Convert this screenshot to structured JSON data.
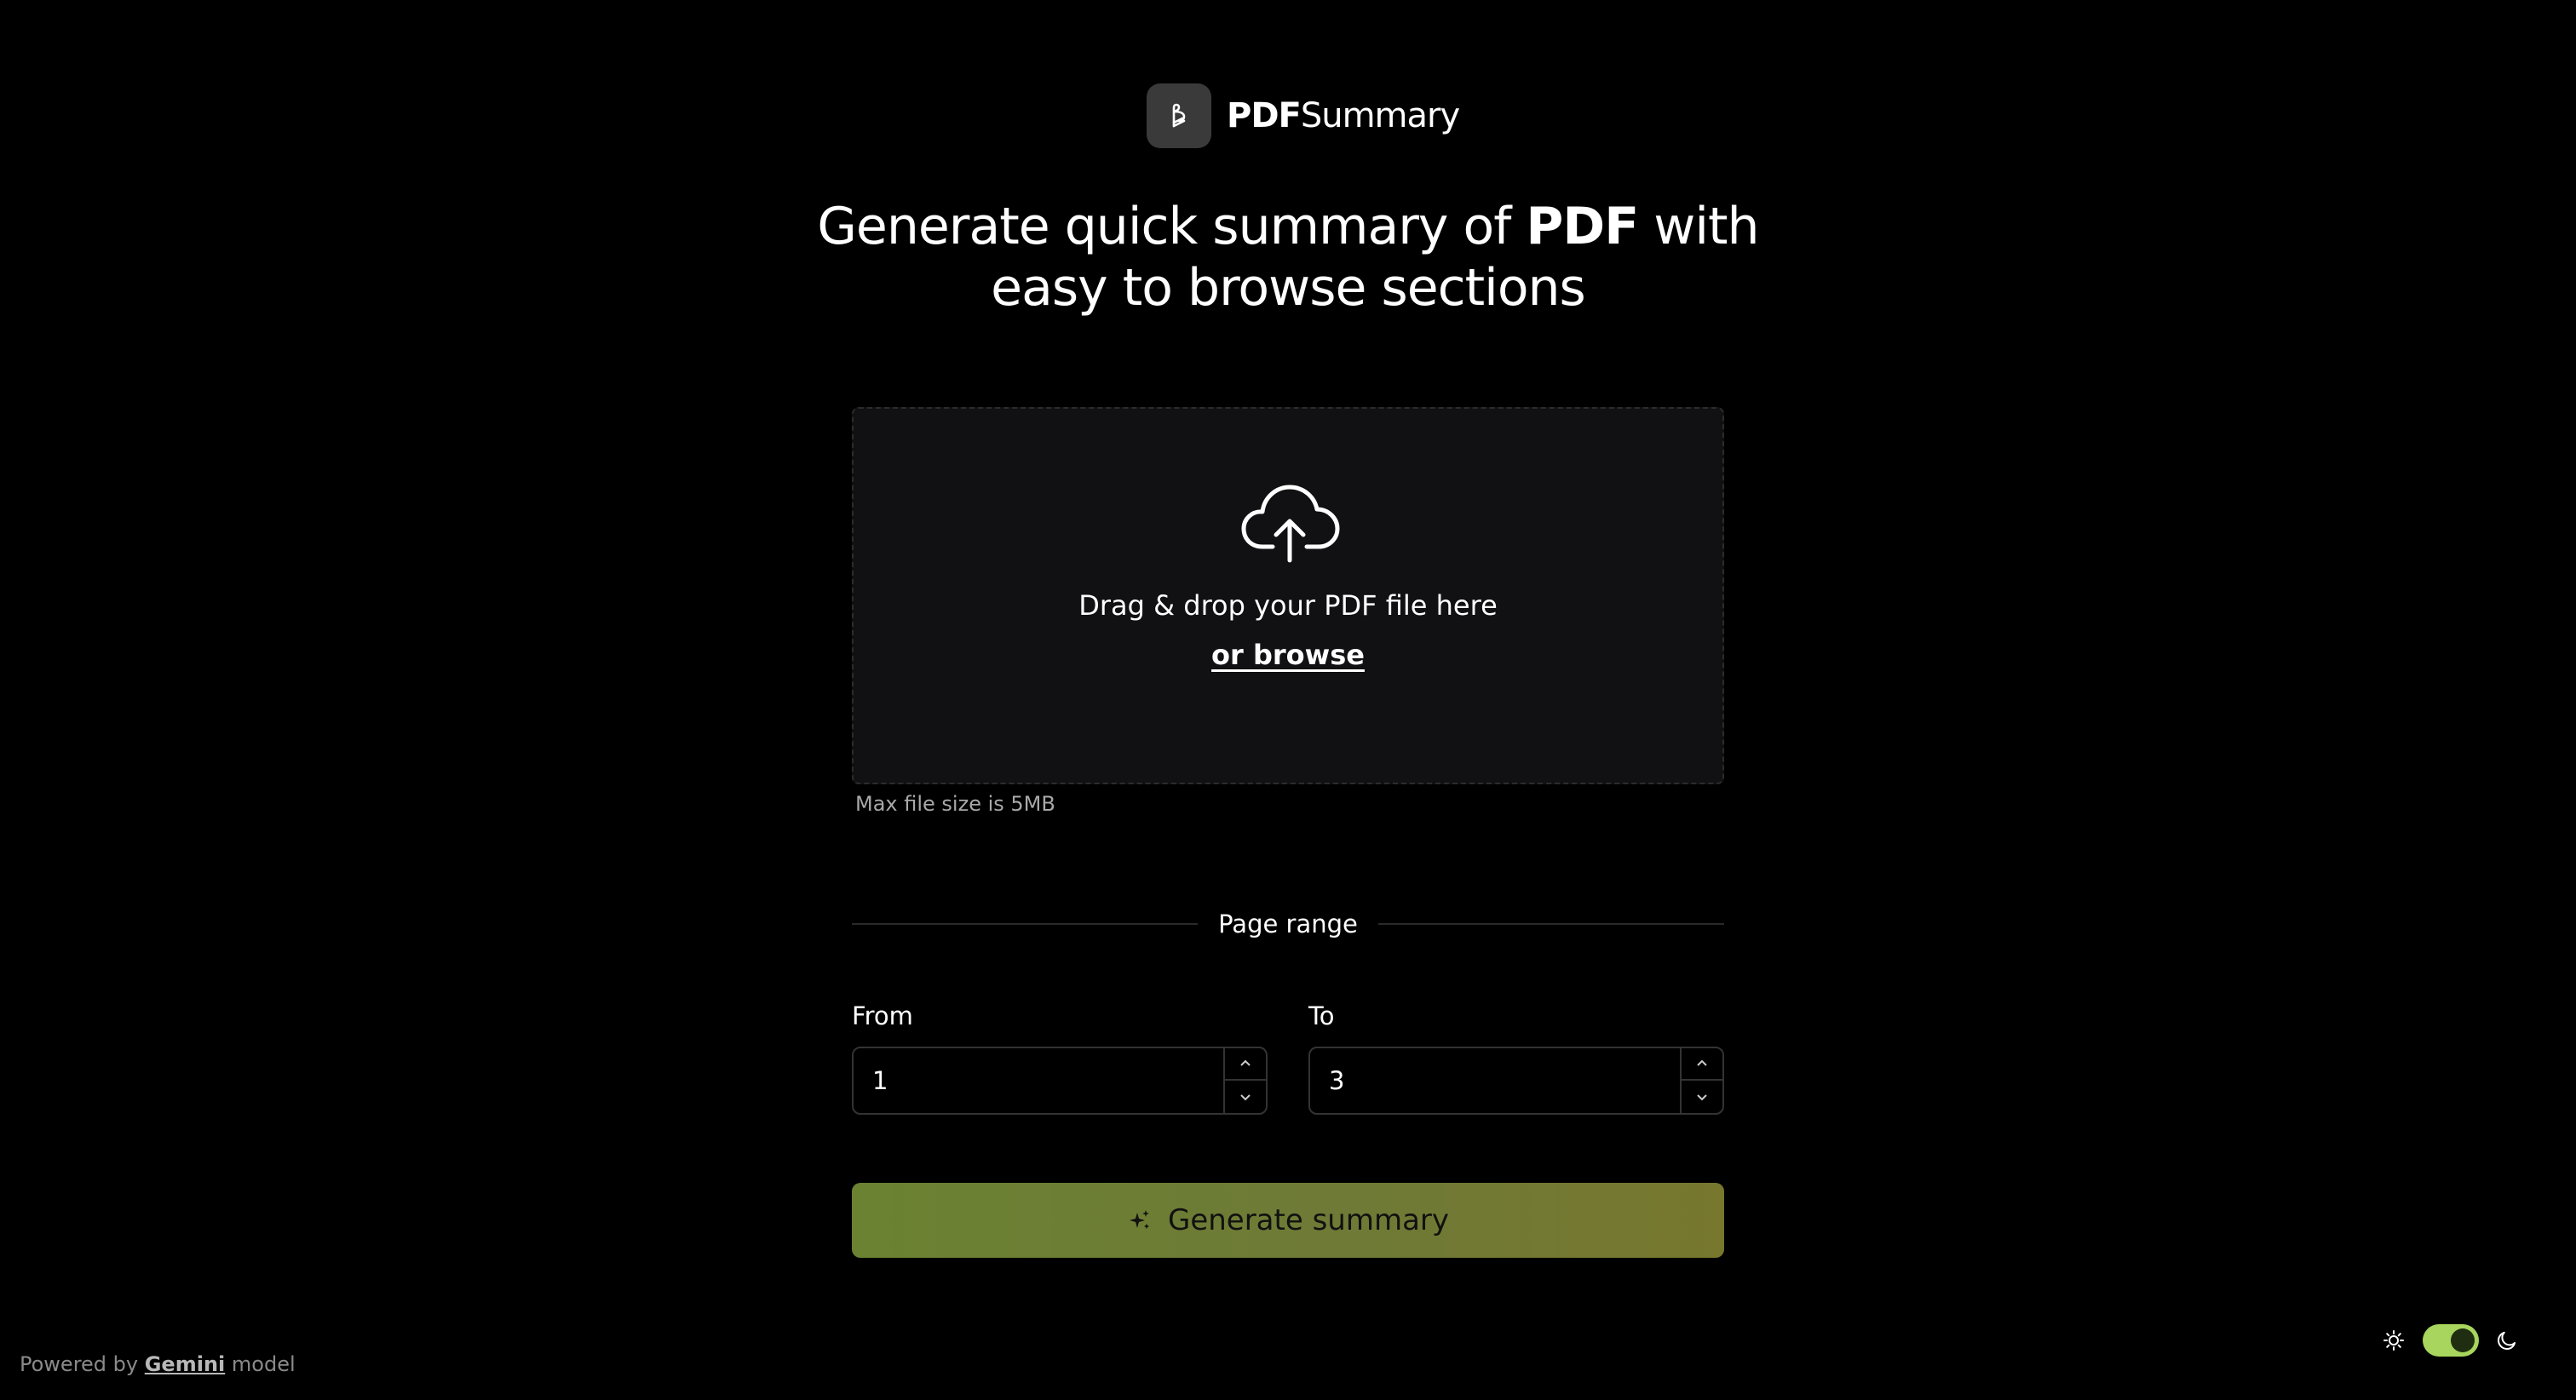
{
  "brand": {
    "name_bold": "PDF",
    "name_regular": "Summary"
  },
  "headline": {
    "part1": "Generate quick summary of ",
    "bold": "PDF",
    "part2": " with easy to browse sections"
  },
  "upload": {
    "drop_text": "Drag & drop your PDF file here",
    "browse_label": "or browse",
    "max_size_note": "Max file size is 5MB"
  },
  "page_range": {
    "title": "Page range",
    "from_label": "From",
    "from_value": "1",
    "to_label": "To",
    "to_value": "3"
  },
  "generate_button": {
    "label": "Generate summary"
  },
  "footer": {
    "powered_prefix": "Powered by ",
    "powered_link": "Gemini",
    "powered_suffix": " model"
  },
  "theme": {
    "mode": "dark",
    "toggle_on": true,
    "toggle_color": "#a7d55d"
  }
}
